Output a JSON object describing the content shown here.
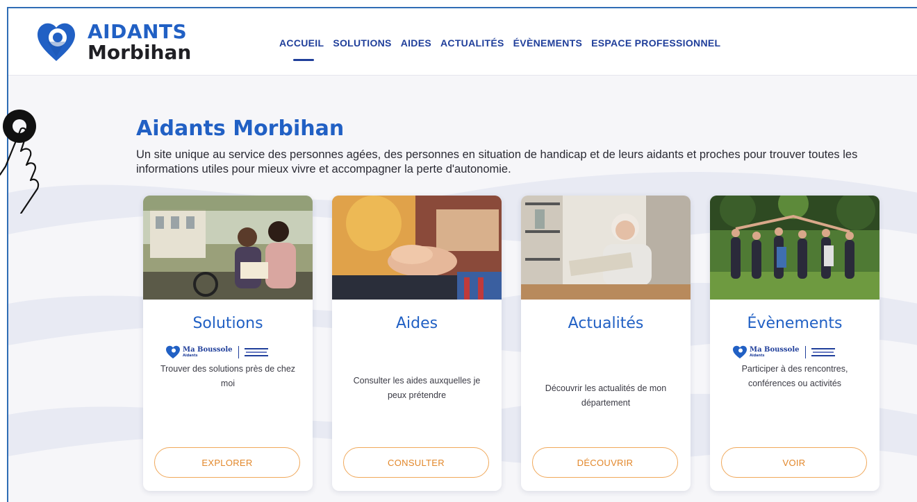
{
  "logo": {
    "line1": "AIDANTS",
    "line2": "Morbihan",
    "icon": "heart-pin-icon"
  },
  "nav": {
    "items": [
      {
        "label": "ACCUEIL",
        "active": true
      },
      {
        "label": "SOLUTIONS",
        "active": false
      },
      {
        "label": "AIDES",
        "active": false
      },
      {
        "label": "ACTUALITÉS",
        "active": false
      },
      {
        "label": "ÉVÈNEMENTS",
        "active": false
      },
      {
        "label": "ESPACE PROFESSIONNEL",
        "active": false
      }
    ]
  },
  "hero": {
    "title": "Aidants Morbihan",
    "description": "Un site unique au service des personnes agées, des personnes en situation de handicap et de leurs aidants et proches pour trouver toutes les informations utiles pour mieux vivre et accompagner la perte d'autonomie."
  },
  "badge": {
    "name": "Ma Boussole",
    "sub": "Aidants",
    "icon": "heart-pin-icon"
  },
  "cards": [
    {
      "title": "Solutions",
      "text": "Trouver des solutions près de chez moi",
      "button": "EXPLORER",
      "has_badge": true
    },
    {
      "title": "Aides",
      "text": "Consulter les aides auxquelles je peux prétendre",
      "button": "CONSULTER",
      "has_badge": false
    },
    {
      "title": "Actualités",
      "text": "Découvrir les actualités de mon département",
      "button": "DÉCOUVRIR",
      "has_badge": false
    },
    {
      "title": "Évènements",
      "text": "Participer à des rencontres, conférences ou activités",
      "button": "VOIR",
      "has_badge": true
    }
  ],
  "colors": {
    "brand_blue": "#2160c4",
    "nav_blue": "#1f3e9a",
    "accent_orange": "#f0a85a",
    "frame_border": "#2f6db5"
  },
  "cursor": {
    "icon": "hand-pointer-icon"
  }
}
